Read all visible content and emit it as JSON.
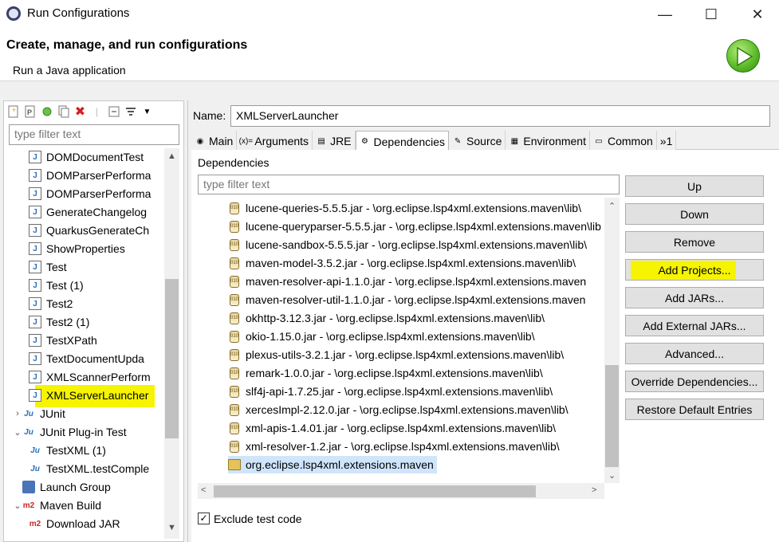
{
  "window": {
    "title": "Run Configurations",
    "controls": {
      "minimize": "—",
      "maximize": "☐",
      "close": "✕"
    }
  },
  "header": {
    "title": "Create, manage, and run configurations",
    "subtitle": "Run a Java application"
  },
  "left": {
    "filter_placeholder": "type filter text",
    "tree": [
      {
        "label": "DOMDocumentTest",
        "icon": "java-app-icon",
        "indent": 2
      },
      {
        "label": "DOMParserPerforma",
        "icon": "java-app-icon",
        "indent": 2
      },
      {
        "label": "DOMParserPerforma",
        "icon": "java-app-icon",
        "indent": 2
      },
      {
        "label": "GenerateChangelog",
        "icon": "java-app-icon",
        "indent": 2
      },
      {
        "label": "QuarkusGenerateCh",
        "icon": "java-app-icon",
        "indent": 2
      },
      {
        "label": "ShowProperties",
        "icon": "java-app-icon",
        "indent": 2
      },
      {
        "label": "Test",
        "icon": "java-app-icon",
        "indent": 2
      },
      {
        "label": "Test (1)",
        "icon": "java-app-icon",
        "indent": 2
      },
      {
        "label": "Test2",
        "icon": "java-app-icon",
        "indent": 2
      },
      {
        "label": "Test2 (1)",
        "icon": "java-app-icon",
        "indent": 2
      },
      {
        "label": "TestXPath",
        "icon": "java-app-icon",
        "indent": 2
      },
      {
        "label": "TextDocumentUpda",
        "icon": "java-app-icon",
        "indent": 2
      },
      {
        "label": "XMLScannerPerform",
        "icon": "java-app-icon",
        "indent": 2
      },
      {
        "label": "XMLServerLauncher",
        "icon": "java-app-icon",
        "indent": 2,
        "selected": true
      },
      {
        "label": "JUnit",
        "icon": "junit-icon",
        "indent": 1,
        "twisty": "›"
      },
      {
        "label": "JUnit Plug-in Test",
        "icon": "junit-plugin-icon",
        "indent": 1,
        "twisty": "⌄"
      },
      {
        "label": "TestXML (1)",
        "icon": "junit-plugin-icon",
        "indent": 2
      },
      {
        "label": "TestXML.testComple",
        "icon": "junit-plugin-icon",
        "indent": 2
      },
      {
        "label": "Launch Group",
        "icon": "launch-group-icon",
        "indent": 1
      },
      {
        "label": "Maven Build",
        "icon": "maven-icon",
        "indent": 1,
        "twisty": "⌄"
      },
      {
        "label": "Download JAR",
        "icon": "maven-icon",
        "indent": 2
      }
    ]
  },
  "right": {
    "name_label": "Name:",
    "name_value": "XMLServerLauncher",
    "tabs": [
      {
        "label": "Main",
        "icon": "main-tab-icon"
      },
      {
        "label": "Arguments",
        "icon": "arguments-tab-icon"
      },
      {
        "label": "JRE",
        "icon": "jre-tab-icon"
      },
      {
        "label": "Dependencies",
        "icon": "dependencies-tab-icon",
        "active": true
      },
      {
        "label": "Source",
        "icon": "source-tab-icon"
      },
      {
        "label": "Environment",
        "icon": "environment-tab-icon"
      },
      {
        "label": "Common",
        "icon": "common-tab-icon"
      },
      {
        "label": "»1",
        "icon": ""
      }
    ],
    "dependencies_label": "Dependencies",
    "filter_placeholder": "type filter text",
    "dependencies": [
      "lucene-queries-5.5.5.jar - \\org.eclipse.lsp4xml.extensions.maven\\lib\\",
      "lucene-queryparser-5.5.5.jar - \\org.eclipse.lsp4xml.extensions.maven\\lib",
      "lucene-sandbox-5.5.5.jar - \\org.eclipse.lsp4xml.extensions.maven\\lib\\",
      "maven-model-3.5.2.jar - \\org.eclipse.lsp4xml.extensions.maven\\lib\\",
      "maven-resolver-api-1.1.0.jar - \\org.eclipse.lsp4xml.extensions.maven",
      "maven-resolver-util-1.1.0.jar - \\org.eclipse.lsp4xml.extensions.maven",
      "okhttp-3.12.3.jar - \\org.eclipse.lsp4xml.extensions.maven\\lib\\",
      "okio-1.15.0.jar - \\org.eclipse.lsp4xml.extensions.maven\\lib\\",
      "plexus-utils-3.2.1.jar - \\org.eclipse.lsp4xml.extensions.maven\\lib\\",
      "remark-1.0.0.jar - \\org.eclipse.lsp4xml.extensions.maven\\lib\\",
      "slf4j-api-1.7.25.jar - \\org.eclipse.lsp4xml.extensions.maven\\lib\\",
      "xercesImpl-2.12.0.jar - \\org.eclipse.lsp4xml.extensions.maven\\lib\\",
      "xml-apis-1.4.01.jar - \\org.eclipse.lsp4xml.extensions.maven\\lib\\",
      "xml-resolver-1.2.jar - \\org.eclipse.lsp4xml.extensions.maven\\lib\\"
    ],
    "project_entry": "org.eclipse.lsp4xml.extensions.maven",
    "buttons": [
      "Up",
      "Down",
      "Remove",
      "Add Projects...",
      "Add JARs...",
      "Add External JARs...",
      "Advanced...",
      "Override Dependencies...",
      "Restore Default Entries"
    ],
    "exclude_test_label": "Exclude test code",
    "exclude_test_checked": true
  },
  "colors": {
    "highlight": "#f6f400",
    "selection": "#cfe5fb",
    "button": "#e1e1e1"
  }
}
